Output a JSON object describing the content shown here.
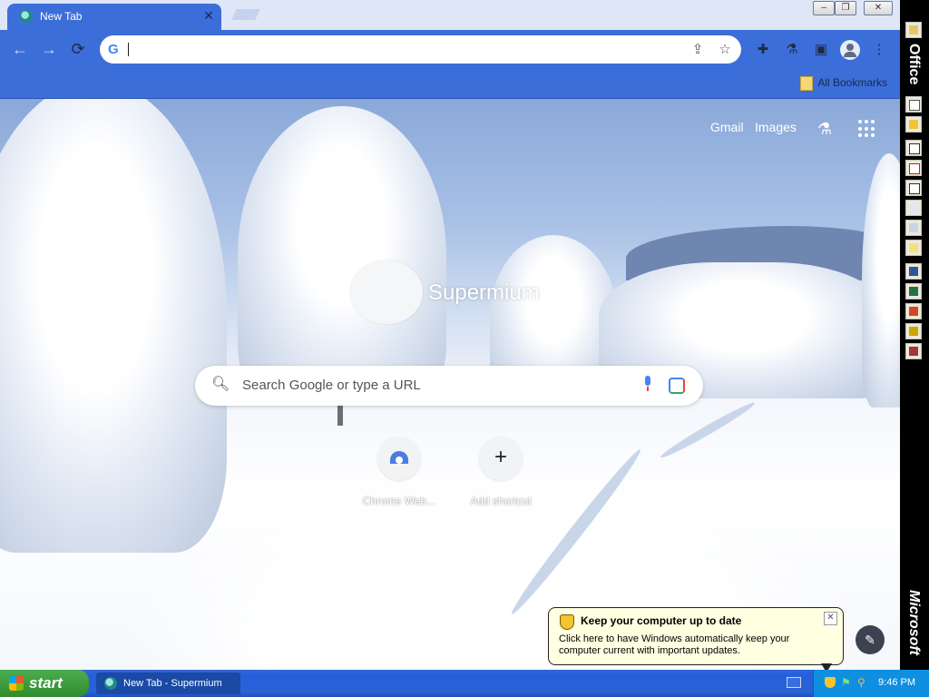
{
  "browser": {
    "tab": {
      "title": "New Tab",
      "close": "✕"
    },
    "window_controls": {
      "minimize": "–",
      "restore": "❐",
      "close": "✕"
    },
    "omnibox": {
      "value": "",
      "placeholder": ""
    },
    "bookmarks_bar": {
      "all_bookmarks": "All Bookmarks"
    }
  },
  "newtab": {
    "top_links": {
      "gmail": "Gmail",
      "images": "Images"
    },
    "logo_text": "Supermium",
    "search": {
      "placeholder": "Search Google or type a URL"
    },
    "shortcuts": [
      {
        "label": "Chrome Web..."
      },
      {
        "label": "Add shortcut"
      }
    ],
    "customize_icon": "pencil-icon"
  },
  "notification": {
    "title": "Keep your computer up to date",
    "body": "Click here to have Windows automatically keep your computer current with important updates.",
    "close": "✕"
  },
  "office_bar": {
    "top_label": "Office",
    "bottom_label": "Microsoft",
    "buttons": [
      "folder-icon",
      "new-document-icon",
      "open-document-icon",
      "mail-icon",
      "calendar-icon",
      "tasks-icon",
      "contacts-icon",
      "journal-icon",
      "notes-icon",
      "word-icon",
      "excel-icon",
      "powerpoint-icon",
      "publisher-icon",
      "access-icon"
    ]
  },
  "taskbar": {
    "start_label": "start",
    "items": [
      {
        "label": "New Tab - Supermium"
      }
    ],
    "clock": "9:46 PM"
  },
  "colors": {
    "chrome_blue": "#3c6ed9",
    "taskbar_blue": "#245edb",
    "start_green": "#2f8b2f",
    "balloon_bg": "#ffffe1",
    "tray_blue": "#0f8fe0"
  }
}
